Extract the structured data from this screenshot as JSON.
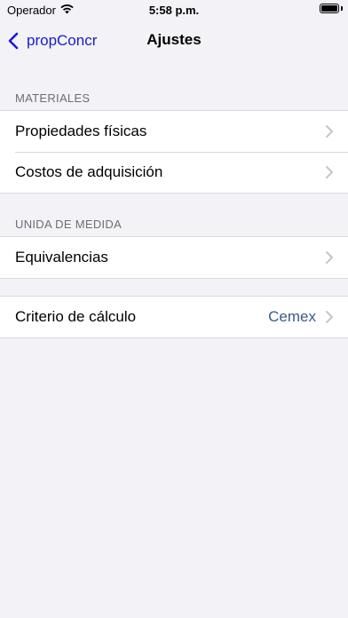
{
  "status_bar": {
    "carrier": "Operador",
    "time": "5:58 p.m."
  },
  "nav": {
    "back_label": "propConcr",
    "title": "Ajustes"
  },
  "sections": {
    "materiales": {
      "header": "MATERIALES",
      "rows": [
        {
          "label": "Propiedades físicas"
        },
        {
          "label": "Costos de adquisición"
        }
      ]
    },
    "unidad": {
      "header": "UNIDA DE MEDIDA",
      "rows": [
        {
          "label": "Equivalencias"
        }
      ]
    },
    "calculo": {
      "rows": [
        {
          "label": "Criterio de cálculo",
          "value": "Cemex"
        }
      ]
    }
  },
  "colors": {
    "accent": "#1a1acc",
    "detail_value": "#3c5a86",
    "background": "#f2f2f7"
  }
}
